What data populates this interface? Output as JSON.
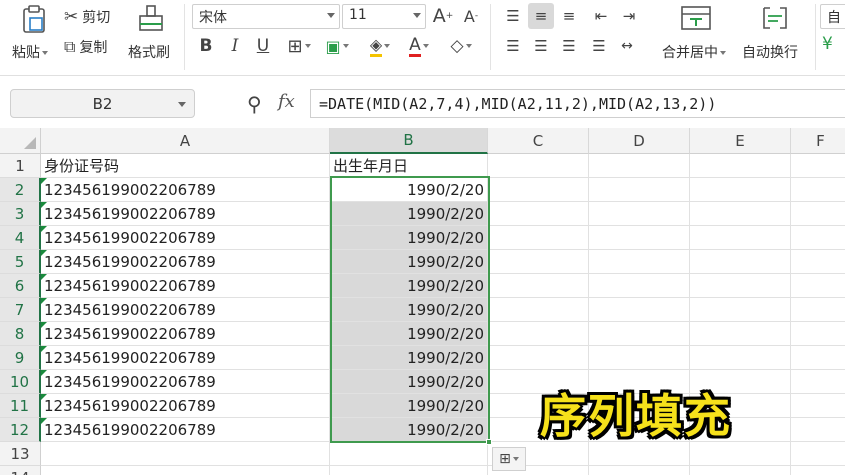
{
  "toolbar": {
    "paste": "粘贴",
    "cut": "剪切",
    "copy": "复制",
    "format_painter": "格式刷",
    "font_name": "宋体",
    "font_size": "11",
    "bold": "B",
    "italic": "I",
    "underline": "U",
    "font_color_letter": "A",
    "grow_font": "A",
    "shrink_font": "A",
    "merge_center": "合并居中",
    "wrap_text": "自动换行",
    "cut_off_right": "自",
    "accent_color": "#217346",
    "font_color_bar": "#e02020"
  },
  "formula_bar": {
    "name_box": "B2",
    "fx_label": "fx",
    "formula": "=DATE(MID(A2,7,4),MID(A2,11,2),MID(A2,13,2))"
  },
  "columns": [
    "A",
    "B",
    "C",
    "D",
    "E",
    "F"
  ],
  "rows": [
    {
      "num": "1",
      "a": "身份证号码",
      "b": "出生年月日"
    },
    {
      "num": "2",
      "a": "123456199002206789",
      "b": "1990/2/20"
    },
    {
      "num": "3",
      "a": "123456199002206789",
      "b": "1990/2/20"
    },
    {
      "num": "4",
      "a": "123456199002206789",
      "b": "1990/2/20"
    },
    {
      "num": "5",
      "a": "123456199002206789",
      "b": "1990/2/20"
    },
    {
      "num": "6",
      "a": "123456199002206789",
      "b": "1990/2/20"
    },
    {
      "num": "7",
      "a": "123456199002206789",
      "b": "1990/2/20"
    },
    {
      "num": "8",
      "a": "123456199002206789",
      "b": "1990/2/20"
    },
    {
      "num": "9",
      "a": "123456199002206789",
      "b": "1990/2/20"
    },
    {
      "num": "10",
      "a": "123456199002206789",
      "b": "1990/2/20"
    },
    {
      "num": "11",
      "a": "123456199002206789",
      "b": "1990/2/20"
    },
    {
      "num": "12",
      "a": "123456199002206789",
      "b": "1990/2/20"
    },
    {
      "num": "13",
      "a": "",
      "b": ""
    },
    {
      "num": "14",
      "a": "",
      "b": ""
    }
  ],
  "overlay_caption": "序列填充"
}
